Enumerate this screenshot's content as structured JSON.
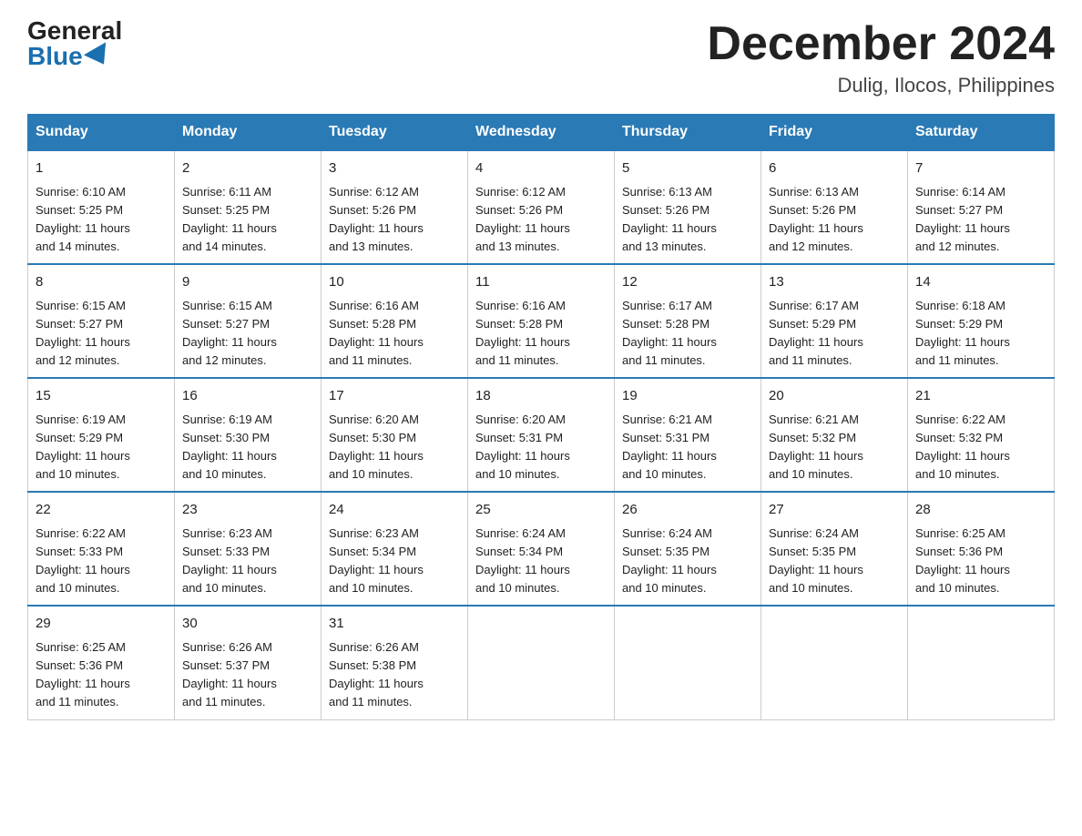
{
  "logo": {
    "general": "General",
    "blue": "Blue"
  },
  "header": {
    "month": "December 2024",
    "location": "Dulig, Ilocos, Philippines"
  },
  "days_of_week": [
    "Sunday",
    "Monday",
    "Tuesday",
    "Wednesday",
    "Thursday",
    "Friday",
    "Saturday"
  ],
  "weeks": [
    [
      {
        "day": "1",
        "sunrise": "6:10 AM",
        "sunset": "5:25 PM",
        "daylight": "11 hours and 14 minutes."
      },
      {
        "day": "2",
        "sunrise": "6:11 AM",
        "sunset": "5:25 PM",
        "daylight": "11 hours and 14 minutes."
      },
      {
        "day": "3",
        "sunrise": "6:12 AM",
        "sunset": "5:26 PM",
        "daylight": "11 hours and 13 minutes."
      },
      {
        "day": "4",
        "sunrise": "6:12 AM",
        "sunset": "5:26 PM",
        "daylight": "11 hours and 13 minutes."
      },
      {
        "day": "5",
        "sunrise": "6:13 AM",
        "sunset": "5:26 PM",
        "daylight": "11 hours and 13 minutes."
      },
      {
        "day": "6",
        "sunrise": "6:13 AM",
        "sunset": "5:26 PM",
        "daylight": "11 hours and 12 minutes."
      },
      {
        "day": "7",
        "sunrise": "6:14 AM",
        "sunset": "5:27 PM",
        "daylight": "11 hours and 12 minutes."
      }
    ],
    [
      {
        "day": "8",
        "sunrise": "6:15 AM",
        "sunset": "5:27 PM",
        "daylight": "11 hours and 12 minutes."
      },
      {
        "day": "9",
        "sunrise": "6:15 AM",
        "sunset": "5:27 PM",
        "daylight": "11 hours and 12 minutes."
      },
      {
        "day": "10",
        "sunrise": "6:16 AM",
        "sunset": "5:28 PM",
        "daylight": "11 hours and 11 minutes."
      },
      {
        "day": "11",
        "sunrise": "6:16 AM",
        "sunset": "5:28 PM",
        "daylight": "11 hours and 11 minutes."
      },
      {
        "day": "12",
        "sunrise": "6:17 AM",
        "sunset": "5:28 PM",
        "daylight": "11 hours and 11 minutes."
      },
      {
        "day": "13",
        "sunrise": "6:17 AM",
        "sunset": "5:29 PM",
        "daylight": "11 hours and 11 minutes."
      },
      {
        "day": "14",
        "sunrise": "6:18 AM",
        "sunset": "5:29 PM",
        "daylight": "11 hours and 11 minutes."
      }
    ],
    [
      {
        "day": "15",
        "sunrise": "6:19 AM",
        "sunset": "5:29 PM",
        "daylight": "11 hours and 10 minutes."
      },
      {
        "day": "16",
        "sunrise": "6:19 AM",
        "sunset": "5:30 PM",
        "daylight": "11 hours and 10 minutes."
      },
      {
        "day": "17",
        "sunrise": "6:20 AM",
        "sunset": "5:30 PM",
        "daylight": "11 hours and 10 minutes."
      },
      {
        "day": "18",
        "sunrise": "6:20 AM",
        "sunset": "5:31 PM",
        "daylight": "11 hours and 10 minutes."
      },
      {
        "day": "19",
        "sunrise": "6:21 AM",
        "sunset": "5:31 PM",
        "daylight": "11 hours and 10 minutes."
      },
      {
        "day": "20",
        "sunrise": "6:21 AM",
        "sunset": "5:32 PM",
        "daylight": "11 hours and 10 minutes."
      },
      {
        "day": "21",
        "sunrise": "6:22 AM",
        "sunset": "5:32 PM",
        "daylight": "11 hours and 10 minutes."
      }
    ],
    [
      {
        "day": "22",
        "sunrise": "6:22 AM",
        "sunset": "5:33 PM",
        "daylight": "11 hours and 10 minutes."
      },
      {
        "day": "23",
        "sunrise": "6:23 AM",
        "sunset": "5:33 PM",
        "daylight": "11 hours and 10 minutes."
      },
      {
        "day": "24",
        "sunrise": "6:23 AM",
        "sunset": "5:34 PM",
        "daylight": "11 hours and 10 minutes."
      },
      {
        "day": "25",
        "sunrise": "6:24 AM",
        "sunset": "5:34 PM",
        "daylight": "11 hours and 10 minutes."
      },
      {
        "day": "26",
        "sunrise": "6:24 AM",
        "sunset": "5:35 PM",
        "daylight": "11 hours and 10 minutes."
      },
      {
        "day": "27",
        "sunrise": "6:24 AM",
        "sunset": "5:35 PM",
        "daylight": "11 hours and 10 minutes."
      },
      {
        "day": "28",
        "sunrise": "6:25 AM",
        "sunset": "5:36 PM",
        "daylight": "11 hours and 10 minutes."
      }
    ],
    [
      {
        "day": "29",
        "sunrise": "6:25 AM",
        "sunset": "5:36 PM",
        "daylight": "11 hours and 11 minutes."
      },
      {
        "day": "30",
        "sunrise": "6:26 AM",
        "sunset": "5:37 PM",
        "daylight": "11 hours and 11 minutes."
      },
      {
        "day": "31",
        "sunrise": "6:26 AM",
        "sunset": "5:38 PM",
        "daylight": "11 hours and 11 minutes."
      },
      null,
      null,
      null,
      null
    ]
  ],
  "labels": {
    "sunrise": "Sunrise:",
    "sunset": "Sunset:",
    "daylight": "Daylight:"
  }
}
